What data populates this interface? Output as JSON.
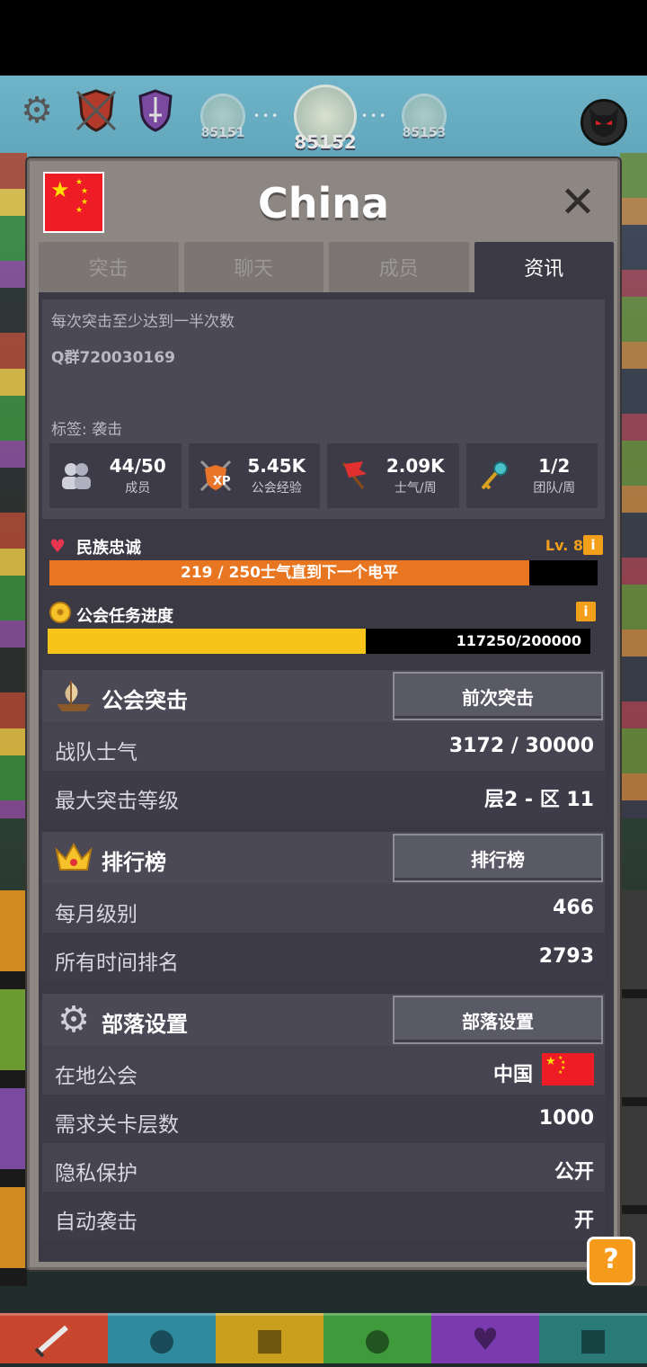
{
  "hud": {
    "stages": [
      "85151",
      "85152",
      "85153"
    ],
    "icons": [
      "gear-icon",
      "shield-icon",
      "sword-icon",
      "demon-icon"
    ]
  },
  "modal": {
    "title": "China",
    "tabs": [
      "突击",
      "聊天",
      "成员",
      "资讯"
    ],
    "active_tab": "资讯",
    "info": {
      "description": "每次突击至少达到一半次数",
      "qq": "Q群720030169",
      "tag": "标签: 袭击"
    },
    "stats": [
      {
        "icon": "members-icon",
        "value": "44/50",
        "label": "成员"
      },
      {
        "icon": "xp-shield-icon",
        "value": "5.45K",
        "label": "公会经验"
      },
      {
        "icon": "flag-icon",
        "value": "2.09K",
        "label": "士气/周"
      },
      {
        "icon": "key-icon",
        "value": "1/2",
        "label": "团队/周"
      }
    ],
    "loyalty": {
      "title": "民族忠诚",
      "level": "Lv. 8",
      "progress": 0.876,
      "text": "219 / 250士气直到下一个电平"
    },
    "quest": {
      "title": "公会任务进度",
      "progress": 0.586,
      "text": "117250/200000"
    },
    "raid": {
      "title": "公会突击",
      "button": "前次突击",
      "rows": [
        {
          "label": "战队士气",
          "value": "3172 / 30000"
        },
        {
          "label": "最大突击等级",
          "value": "层2 - 区 11"
        }
      ]
    },
    "leaderboard": {
      "title": "排行榜",
      "button": "排行榜",
      "rows": [
        {
          "label": "每月级别",
          "value": "466"
        },
        {
          "label": "所有时间排名",
          "value": "2793"
        }
      ]
    },
    "settings": {
      "title": "部落设置",
      "button": "部落设置",
      "rows": [
        {
          "label": "在地公会",
          "value": "中国"
        },
        {
          "label": "需求关卡层数",
          "value": "1000"
        },
        {
          "label": "隐私保护",
          "value": "公开"
        },
        {
          "label": "自动袭击",
          "value": "开"
        }
      ]
    }
  },
  "help_label": "?",
  "close_label": "✕",
  "colors": {
    "accent_orange": "#e87520",
    "quest_yellow": "#f7c51a",
    "panel_dark": "#3b3a44",
    "frame_gray": "#8d8784"
  }
}
